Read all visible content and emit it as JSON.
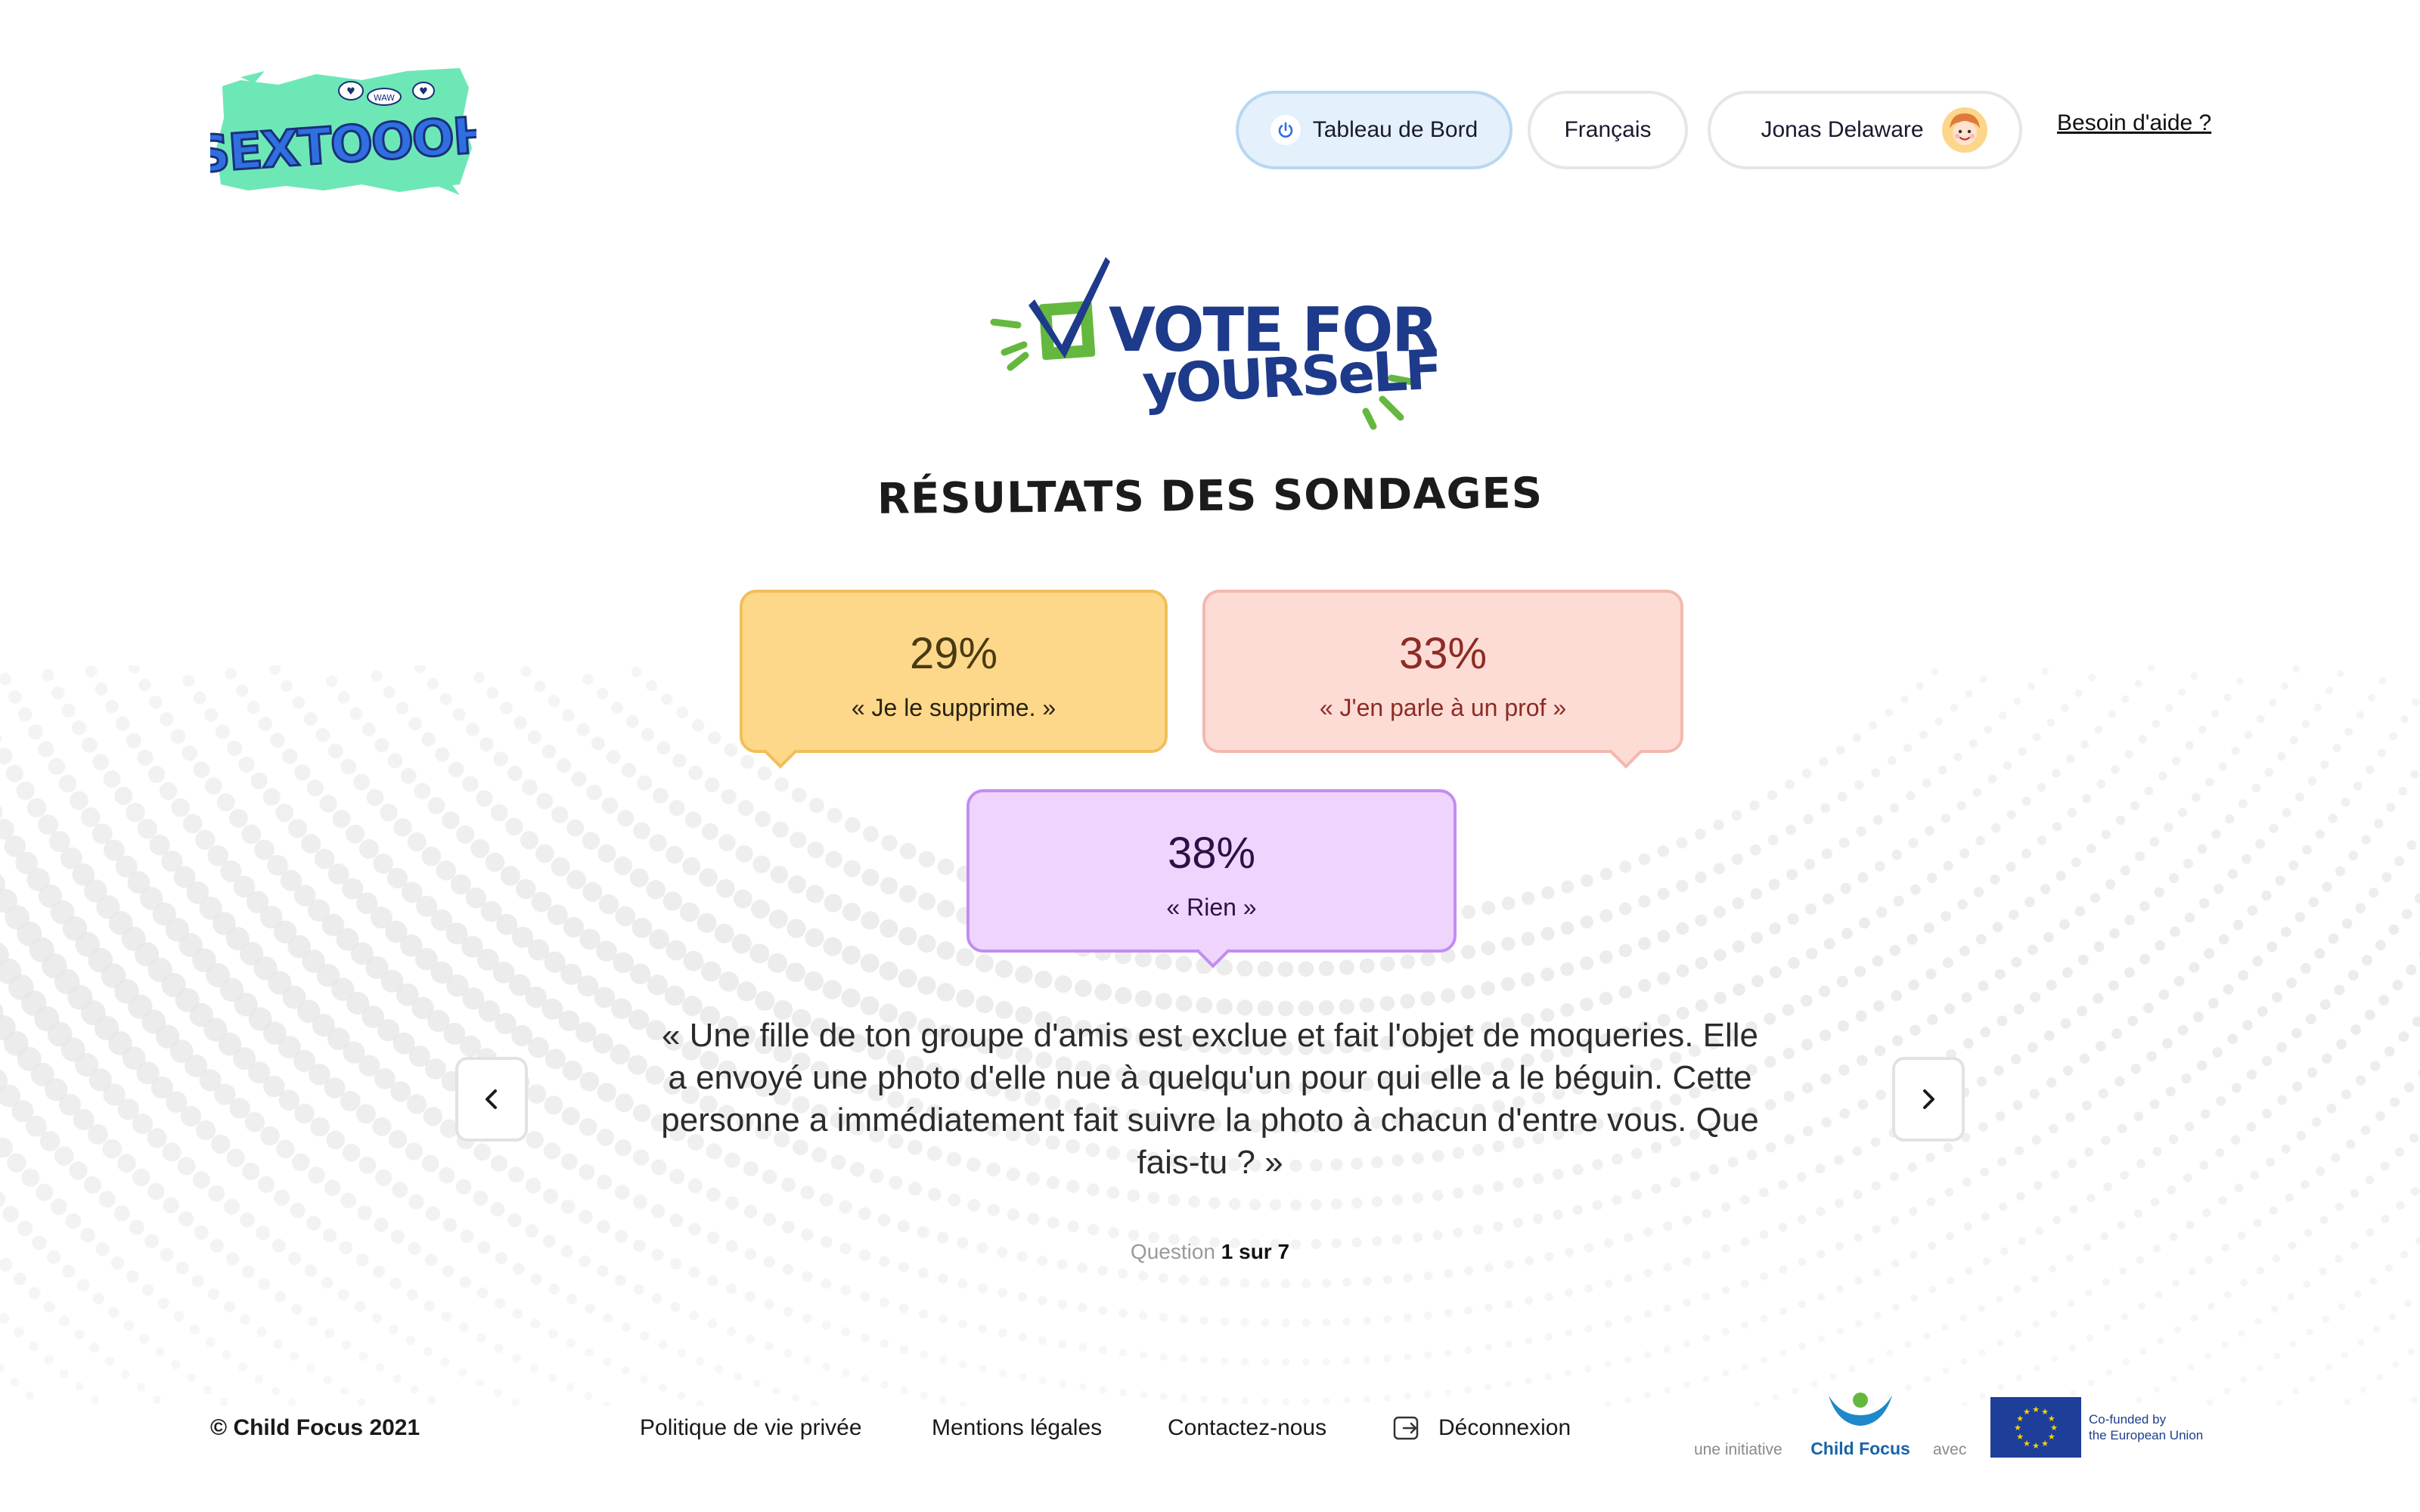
{
  "header": {
    "logo_text": "SEXTOOOH",
    "logo_bubbles": [
      "♥",
      "WAW",
      "♥"
    ],
    "nav": {
      "dashboard_label": "Tableau de Bord",
      "language_label": "Français",
      "user_name": "Jonas Delaware"
    },
    "help_label": "Besoin d'aide ?"
  },
  "main": {
    "vote_logo": {
      "line1": "VOTE FOR",
      "line2": "yOURSeLF"
    },
    "results_title": "RÉSULTATS DES SONDAGES",
    "results": [
      {
        "percent": "29%",
        "value": 29,
        "answer": "« Je le supprime. »",
        "color": "#fdd88b"
      },
      {
        "percent": "33%",
        "value": 33,
        "answer": "« J'en parle à un prof »",
        "color": "#fedcd6"
      },
      {
        "percent": "38%",
        "value": 38,
        "answer": "« Rien »",
        "color": "#efd5fd"
      }
    ],
    "question_text": "« Une fille de ton groupe d'amis est exclue et fait l'objet de moqueries. Elle a envoyé une photo d'elle nue à quelqu'un pour qui elle a le béguin. Cette personne a immédiatement fait suivre la photo à chacun d'entre vous. Que fais-tu ? »",
    "counter": {
      "label": "Question",
      "value": "1 sur 7"
    }
  },
  "footer": {
    "copyright": "© Child Focus 2021",
    "links": {
      "privacy": "Politique de vie privée",
      "legal": "Mentions légales",
      "contact": "Contactez-nous",
      "logout": "Déconnexion"
    },
    "initiative_label": "une initiative",
    "child_focus_name": "Child Focus",
    "avec_label": "avec",
    "eu_line1": "Co-funded by",
    "eu_line2": "the European Union"
  },
  "colors": {
    "accent_blue": "#1f5fbf",
    "brand_green": "#6ee7b7",
    "vote_navy": "#1e3a8a",
    "vote_green": "#65b83f",
    "eu_blue": "#1d3f9a",
    "eu_yellow": "#ffd200"
  },
  "icons": {
    "dashboard": "power-icon",
    "user": "avatar-icon",
    "prev": "chevron-left-icon",
    "next": "chevron-right-icon",
    "logout": "logout-icon"
  }
}
